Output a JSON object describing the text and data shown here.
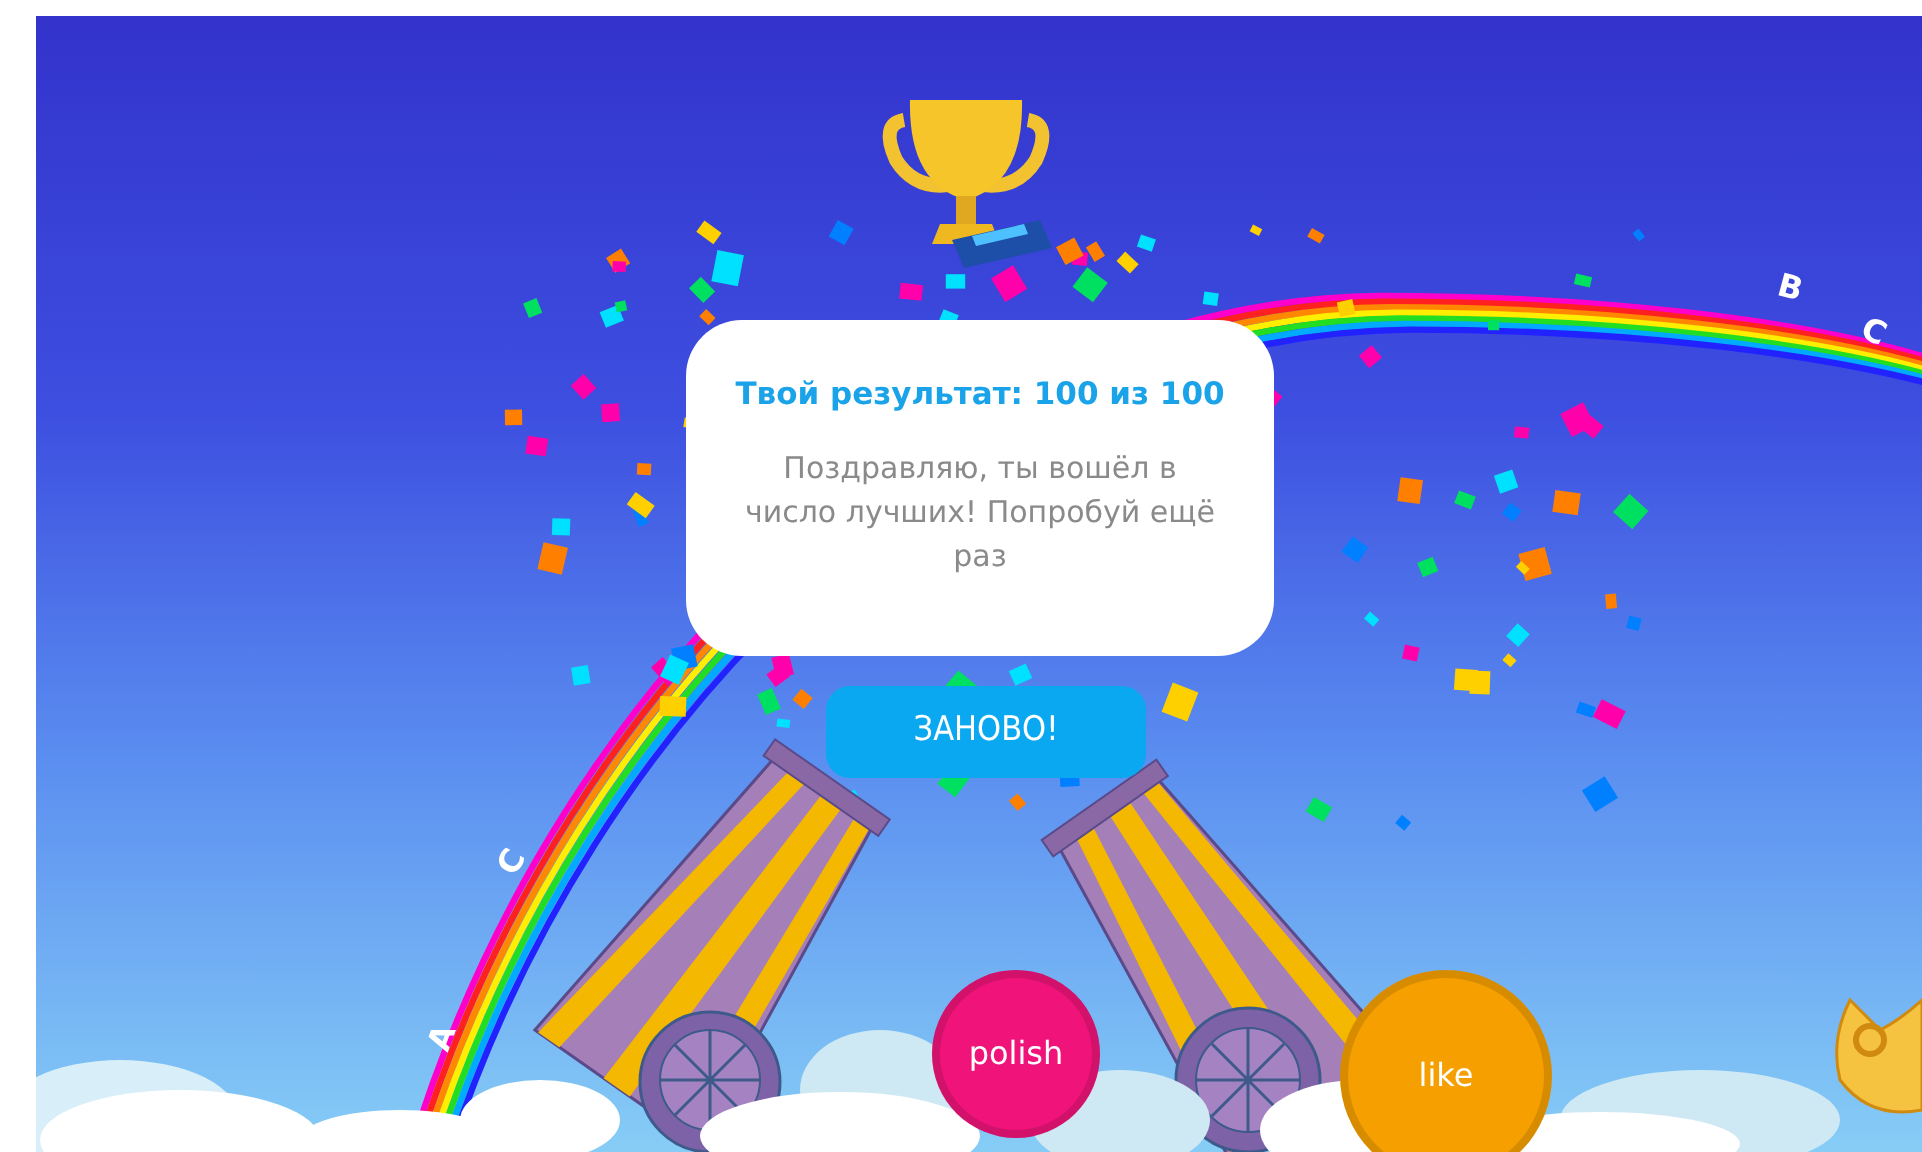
{
  "result_card": {
    "title": "Твой результат: 100 из 100",
    "message": "Поздравляю, ты вошёл в число лучших! Попробуй ещё раз"
  },
  "restart_button": "ЗАНОВО!",
  "balloons": [
    {
      "label": "polish",
      "color": "#f0147a"
    },
    {
      "label": "like",
      "color": "#f5a000"
    }
  ],
  "rainbow_letters": [
    "B",
    "C",
    "C",
    "A"
  ]
}
